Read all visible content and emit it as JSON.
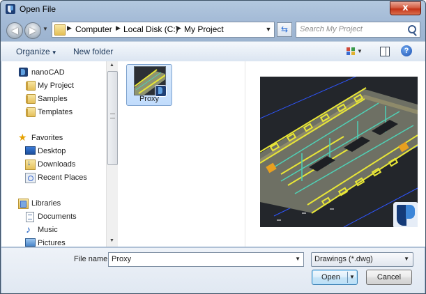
{
  "window": {
    "title": "Open File",
    "close_glyph": "x"
  },
  "nav": {
    "back_glyph": "◀",
    "forward_glyph": "▶",
    "recent_glyph": "▼"
  },
  "address": {
    "crumbs": [
      "Computer",
      "Local Disk (C:)",
      "My Project"
    ],
    "separator_glyph": "▶",
    "dropdown_glyph": "▼",
    "refresh_glyph": "⇆"
  },
  "search": {
    "placeholder": "Search My Project"
  },
  "toolbar": {
    "organize_label": "Organize",
    "organize_arrow": "▼",
    "new_folder_label": "New folder",
    "views_arrow": "▼",
    "help_glyph": "?"
  },
  "sidebar": {
    "items": [
      {
        "label": "nanoCAD",
        "icon": "nanocad-icon"
      },
      {
        "label": "My Project",
        "icon": "folder-icon"
      },
      {
        "label": "Samples",
        "icon": "folder-icon"
      },
      {
        "label": "Templates",
        "icon": "folder-icon"
      },
      {
        "label": "Favorites",
        "icon": "star-icon"
      },
      {
        "label": "Desktop",
        "icon": "desktop-icon"
      },
      {
        "label": "Downloads",
        "icon": "downloads-icon"
      },
      {
        "label": "Recent Places",
        "icon": "recent-places-icon"
      },
      {
        "label": "Libraries",
        "icon": "libraries-icon"
      },
      {
        "label": "Documents",
        "icon": "documents-icon"
      },
      {
        "label": "Music",
        "icon": "music-icon"
      },
      {
        "label": "Pictures",
        "icon": "pictures-icon"
      }
    ],
    "scroll_up": "▲",
    "scroll_down": "▼"
  },
  "files": [
    {
      "name": "Proxy",
      "selected": true
    }
  ],
  "bottom": {
    "file_name_label": "File name:",
    "file_name_value": "Proxy",
    "file_type_value": "Drawings (*.dwg)",
    "dropdown_glyph": "▼",
    "open_label": "Open",
    "cancel_label": "Cancel"
  },
  "colors": {
    "accent": "#3c7fb1",
    "close_red": "#c53418",
    "selection": "#c1dcfc",
    "drawing_bg": "#23262b",
    "drawing_yellow": "#e8e637",
    "drawing_blue": "#2e55ff"
  }
}
